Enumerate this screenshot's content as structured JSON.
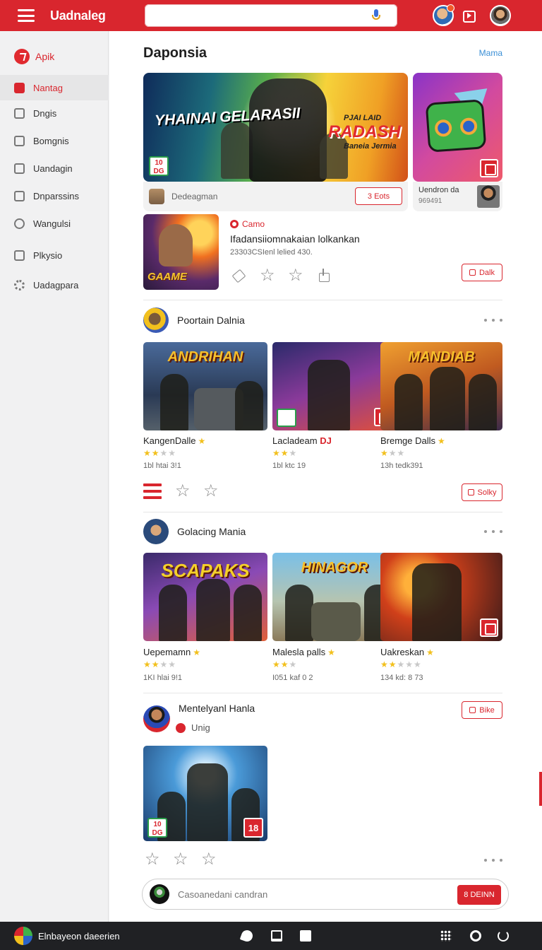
{
  "header": {
    "brand": "Uadnaleg",
    "search_placeholder": "",
    "notification_count": "7"
  },
  "sidebar": {
    "items": [
      {
        "label": "Apik",
        "icon": "app-logo-icon"
      },
      {
        "label": "Nantag",
        "icon": "home-icon"
      },
      {
        "label": "Dngis",
        "icon": "grid-icon"
      },
      {
        "label": "Bomgnis",
        "icon": "folder-icon"
      },
      {
        "label": "Uandagin",
        "icon": "library-icon"
      },
      {
        "label": "Dnparssins",
        "icon": "store-icon"
      },
      {
        "label": "Wangulsi",
        "icon": "camera-icon"
      },
      {
        "label": "Plkysio",
        "icon": "trophy-icon"
      },
      {
        "label": "Uadagpara",
        "icon": "gear-icon"
      }
    ]
  },
  "main": {
    "title": "Daponsia",
    "more_label": "Mama",
    "hero": {
      "banner_left_text": "YHAINAI GELARASII",
      "banner_right_text": "RADASH",
      "banner_right_top": "PJAI LAID",
      "banner_right_sub": "Baneia Jermia",
      "rating_badge": "10 DG",
      "caption": "Dedeagman",
      "button_label": "3 Eots",
      "side_title": "Uendron da",
      "side_sub": "969491"
    },
    "featured_game": {
      "art_text": "GAAME",
      "tag": "Camo",
      "title": "Ifadansiiomnakaian lolkankan",
      "subtitle": "23303CSIenl lelied 430.",
      "button_label": "Dalk"
    },
    "sections": [
      {
        "title": "Poortain Dalnia",
        "cards": [
          {
            "art": "ANDRIHAN",
            "title": "KangenDalle",
            "stars": 3,
            "meta": "1bl htai 3!1"
          },
          {
            "art": "",
            "title": "Lacladeam",
            "title_badge": "DJ",
            "stars": 2,
            "meta": "1bl ktc 19"
          },
          {
            "art": "MANDIAB",
            "title": "Bremge Dalls",
            "stars": 2,
            "meta": "13h tedk391"
          }
        ],
        "button_label": "Solky"
      },
      {
        "title": "Golacing Mania",
        "cards": [
          {
            "art": "SCAPAKS",
            "title": "Uepemamn",
            "stars": 2,
            "meta": "1KI hlai 9!1"
          },
          {
            "art": "HINAGOR",
            "title": "Malesla palls",
            "stars": 2,
            "meta": "I051 kaf 0 2"
          },
          {
            "art": "",
            "title": "Uakreskan",
            "stars": 2,
            "meta": "134 kd: 8 73"
          }
        ]
      },
      {
        "title": "Mentelyanl Hanla",
        "subtitle": "Unig",
        "button_label": "Bike",
        "rating_badge": "10 DG",
        "badge_number": "18"
      }
    ],
    "comment": {
      "placeholder": "Casoanedani candran",
      "send_label": "8 DEINN"
    }
  },
  "taskbar": {
    "label": "Elnbayeon daeerien"
  },
  "colors": {
    "accent": "#d9262e",
    "star": "#f2c01d",
    "link": "#3a8fd6"
  }
}
